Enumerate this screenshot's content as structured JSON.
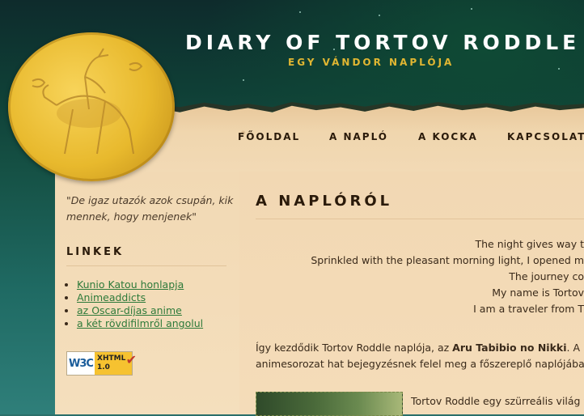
{
  "header": {
    "title": "DIARY OF TORTOV RODDLE",
    "subtitle": "EGY VÁNDOR NAPLÓJA"
  },
  "nav": {
    "items": [
      {
        "label": "FŐOLDAL"
      },
      {
        "label": "A NAPLÓ"
      },
      {
        "label": "A KOCKA"
      },
      {
        "label": "KAPCSOLAT"
      }
    ]
  },
  "sidebar": {
    "quote_line1": "\"De igaz utazók azok csupán, kik",
    "quote_line2": "mennek, hogy menjenek\"",
    "links_title": "LINKEK",
    "links": [
      {
        "label": "Kunio Katou honlapja"
      },
      {
        "label": "Animeaddicts"
      },
      {
        "label": "az Oscar-díjas anime"
      },
      {
        "label": "a két rövdifilmről angolul"
      }
    ],
    "badge": {
      "left": "W3C",
      "right_line1": "XHTML",
      "right_line2": "1.0",
      "check": "✔"
    }
  },
  "main": {
    "title": "A NAPLÓRÓL",
    "poem": [
      "The night gives way t",
      "Sprinkled with the pleasant morning light, I opened m",
      "The journey co",
      "My name is Tortov",
      "I am a traveler from T"
    ],
    "para_line1_a": "Így kezdődik Tortov Roddle naplója, az ",
    "para_line1_b": "Aru Tabibio no Nikki",
    "para_line1_c": ". A hatr",
    "para_line2": "animesorozat hat bejegyzésnek felel meg a főszereplő naplójában.",
    "thumb_text": "Tortov Roddle egy szürreális világ vá"
  }
}
